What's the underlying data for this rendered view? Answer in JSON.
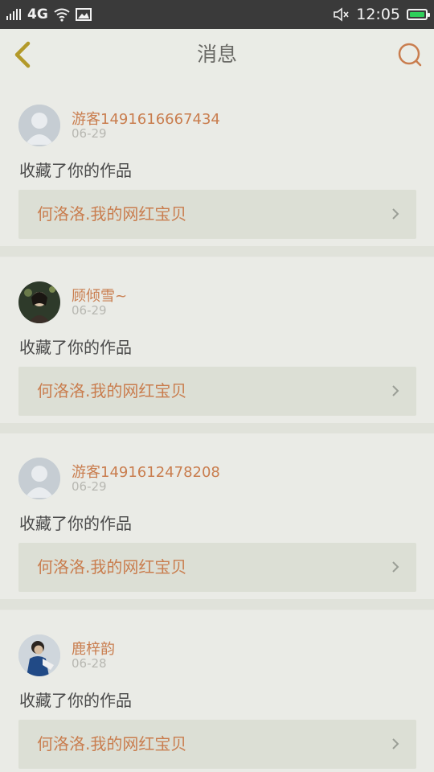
{
  "status_bar": {
    "network": "4G",
    "time": "12:05"
  },
  "header": {
    "title": "消息"
  },
  "messages": [
    {
      "username": "游客1491616667434",
      "date": "06-29",
      "action": "收藏了你的作品",
      "work": "何洛洛.我的网红宝贝"
    },
    {
      "username": "顾倾雪~",
      "date": "06-29",
      "action": "收藏了你的作品",
      "work": "何洛洛.我的网红宝贝"
    },
    {
      "username": "游客1491612478208",
      "date": "06-29",
      "action": "收藏了你的作品",
      "work": "何洛洛.我的网红宝贝"
    },
    {
      "username": "鹿梓韵",
      "date": "06-28",
      "action": "收藏了你的作品",
      "work": "何洛洛.我的网红宝贝"
    }
  ],
  "colors": {
    "accent": "#c97d4e",
    "back_icon": "#b39a2a",
    "battery": "#2fcf5a"
  }
}
